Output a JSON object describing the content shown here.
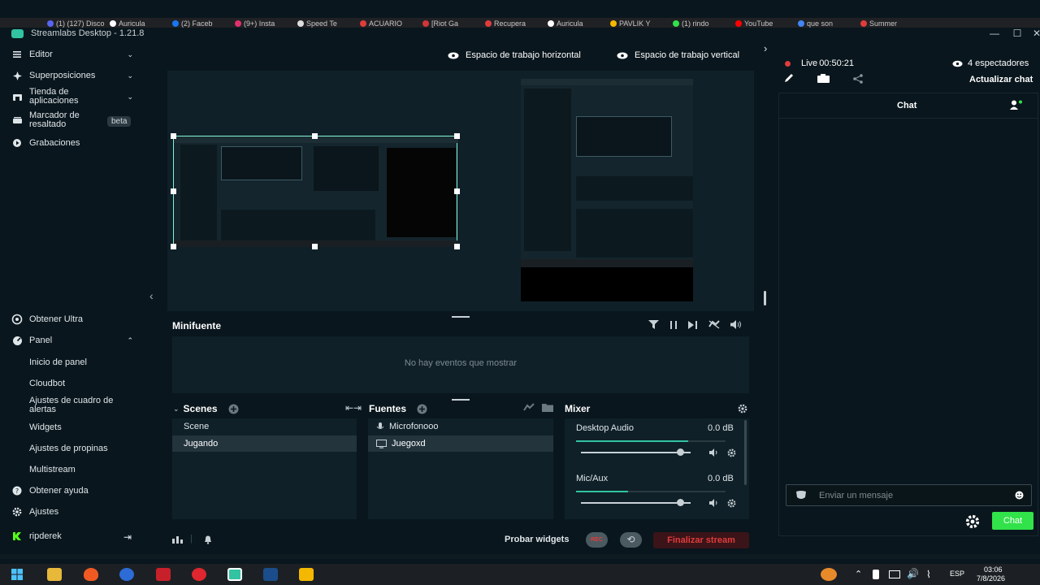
{
  "browser_tabs": [
    "(1) (127) Disco",
    "Auricula",
    "(2) Faceb",
    "(9+) Insta",
    "Speed Te",
    "ACUARIO",
    "[Riot Ga",
    "Recupera",
    "Auricula",
    "PAVLIK Y",
    "(1) rindo",
    "YouTube",
    "que son",
    "Summer"
  ],
  "app": {
    "title": "Streamlabs Desktop - 1.21.8",
    "window_controls": {
      "minimize": "—",
      "maximize": "☐",
      "close": "✕"
    }
  },
  "sidebar": {
    "top_items": [
      {
        "label": "Editor",
        "icon": "editor-icon"
      },
      {
        "label": "Superposiciones",
        "icon": "overlays-icon"
      },
      {
        "label": "Tienda de aplicaciones",
        "icon": "store-icon"
      },
      {
        "label": "Marcador de resaltado",
        "icon": "highlighter-icon",
        "badge": "beta"
      },
      {
        "label": "Grabaciones",
        "icon": "recordings-icon"
      }
    ],
    "collapse_arrow": "‹",
    "bottom_items": {
      "ultra": "Obtener Ultra",
      "panel": "Panel",
      "panel_sub": [
        "Inicio de panel",
        "Cloudbot",
        "Ajustes de cuadro de alertas",
        "Widgets",
        "Ajustes de propinas",
        "Multistream"
      ],
      "help": "Obtener ayuda",
      "settings": "Ajustes",
      "user": "ripderek"
    }
  },
  "workspace": {
    "horizontal": "Espacio de trabajo horizontal",
    "vertical": "Espacio de trabajo vertical"
  },
  "minifeed": {
    "title": "Minifuente",
    "empty": "No hay eventos que mostrar"
  },
  "scenes": {
    "title": "Scenes",
    "items": [
      "Scene",
      "Jugando"
    ],
    "selected": 1
  },
  "sources": {
    "title": "Fuentes",
    "items": [
      {
        "label": "Microfonooo",
        "icon": "mic-icon"
      },
      {
        "label": "Juegoxd",
        "icon": "display-icon"
      }
    ],
    "selected": 1
  },
  "mixer": {
    "title": "Mixer",
    "channels": [
      {
        "name": "Desktop Audio",
        "level": "0.0 dB",
        "volume": 0.9,
        "meter": 0.75
      },
      {
        "name": "Mic/Aux",
        "level": "0.0 dB",
        "volume": 0.9,
        "meter": 0.35
      }
    ]
  },
  "bottom_bar": {
    "test_widgets": "Probar widgets",
    "rec": "REC",
    "end_stream": "Finalizar stream"
  },
  "live": {
    "status": "Live",
    "timer": "00:50:21",
    "viewers": "4 espectadores",
    "refresh_chat": "Actualizar chat"
  },
  "chat": {
    "title": "Chat",
    "placeholder": "Enviar un mensaje",
    "send": "Chat"
  },
  "taskbar": {
    "lang": "ESP",
    "time": "03:06",
    "date": "7/8/2026"
  },
  "colors": {
    "bg": "#09161d",
    "panel": "#0f2028",
    "accent": "#80f5d2",
    "live_red": "#e03c3c",
    "send_green": "#31e24a",
    "end_red": "#e03c3c"
  }
}
